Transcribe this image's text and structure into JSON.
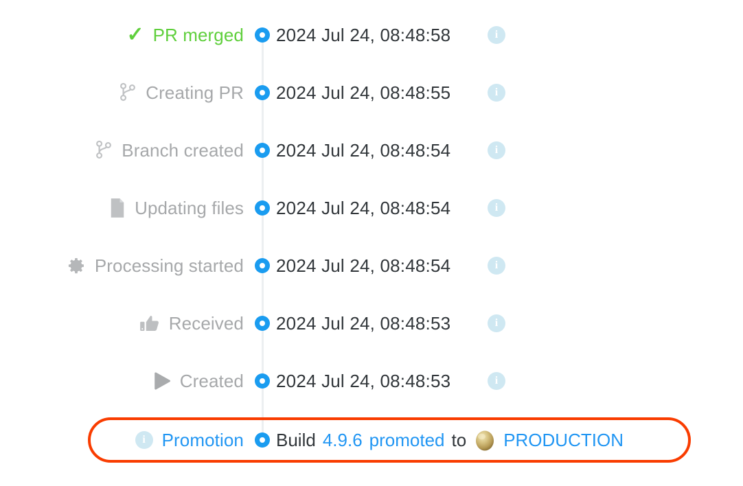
{
  "theme": {
    "marker_blue": "#1a9cf0",
    "link_blue": "#2196f3",
    "success_green": "#5fcf3c",
    "muted_gray": "#a6a8aa",
    "text_dark": "#31363a",
    "highlight_orange": "#f93c00",
    "info_badge_bg": "#cfe8f2",
    "spine_gray": "#eceff1"
  },
  "timeline": {
    "events": [
      {
        "icon": "check-icon",
        "label": "PR merged",
        "label_style": "green",
        "timestamp": "2024 Jul 24, 08:48:58",
        "info": "i"
      },
      {
        "icon": "git-branch-icon",
        "label": "Creating PR",
        "label_style": "muted",
        "timestamp": "2024 Jul 24, 08:48:55",
        "info": "i"
      },
      {
        "icon": "git-branch-icon",
        "label": "Branch created",
        "label_style": "muted",
        "timestamp": "2024 Jul 24, 08:48:54",
        "info": "i"
      },
      {
        "icon": "file-icon",
        "label": "Updating files",
        "label_style": "muted",
        "timestamp": "2024 Jul 24, 08:48:54",
        "info": "i"
      },
      {
        "icon": "gear-icon",
        "label": "Processing started",
        "label_style": "muted",
        "timestamp": "2024 Jul 24, 08:48:54",
        "info": "i"
      },
      {
        "icon": "thumbs-up-icon",
        "label": "Received",
        "label_style": "muted",
        "timestamp": "2024 Jul 24, 08:48:53",
        "info": "i"
      },
      {
        "icon": "play-icon",
        "label": "Created",
        "label_style": "muted",
        "timestamp": "2024 Jul 24, 08:48:53",
        "info": "i"
      }
    ],
    "promotion": {
      "icon": "info-icon",
      "info": "i",
      "label": "Promotion",
      "message_build_word": "Build",
      "build_version": "4.9.6",
      "promoted_word": "promoted",
      "to_word": "to",
      "environment_icon": "gold-sphere-icon",
      "environment": "PRODUCTION"
    }
  }
}
